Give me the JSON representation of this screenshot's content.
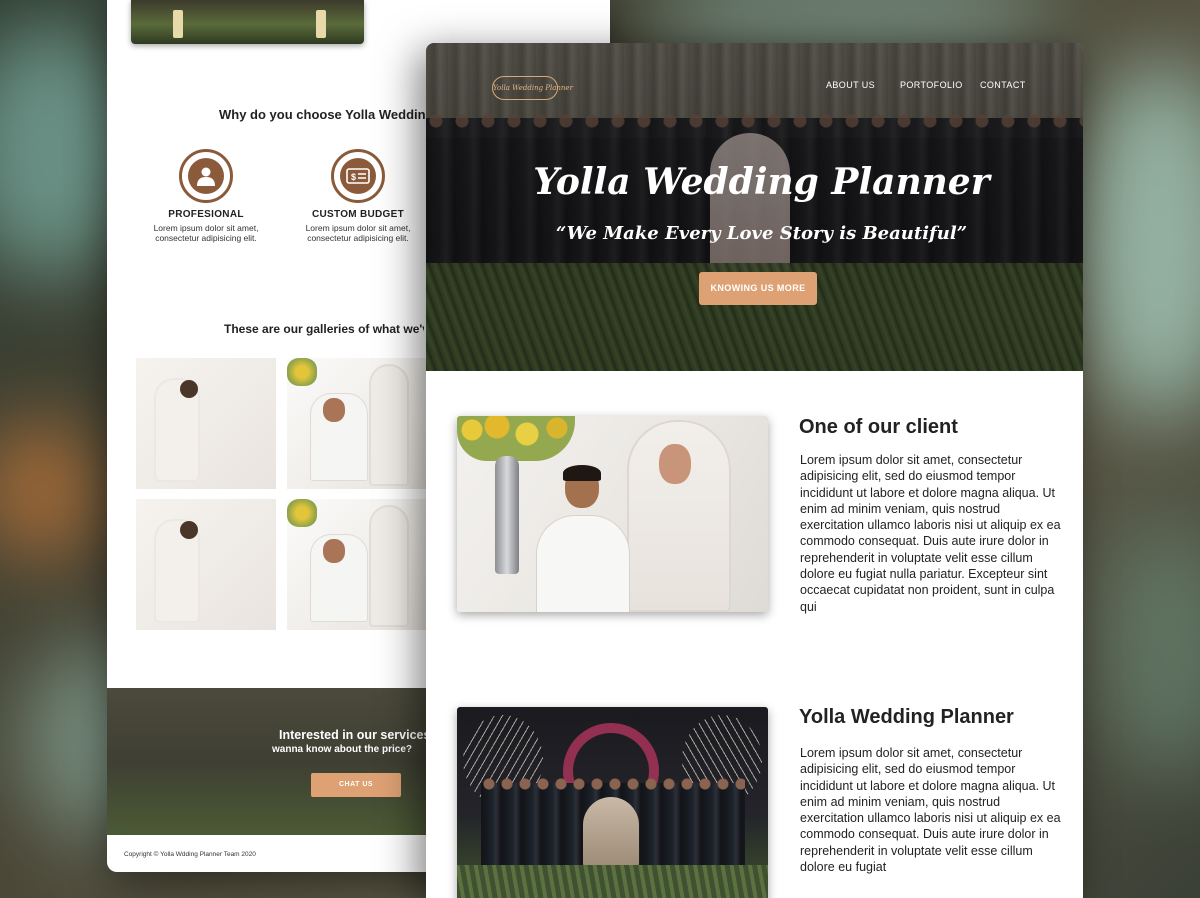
{
  "left_page": {
    "why_title": "Why do you choose Yolla Wedding Planner",
    "features": [
      {
        "icon": "person-icon",
        "title": "PROFESIONAL",
        "desc": "Lorem ipsum dolor sit amet, consectetur adipisicing elit."
      },
      {
        "icon": "budget-icon",
        "title": "CUSTOM BUDGET",
        "desc": "Lorem ipsum dolor sit amet, consectetur adipisicing elit."
      }
    ],
    "gallery_title": "These are our galleries of what we've done",
    "cta": {
      "title": "Interested in our services?",
      "subtitle": "wanna know about the price?",
      "button": "CHAT US"
    },
    "copyright": "Copyright © Yolla Wdding Planner Team 2020"
  },
  "right_page": {
    "logo_text": "Yolla Wedding Planner",
    "nav": [
      "ABOUT US",
      "PORTOFOLIO",
      "CONTACT"
    ],
    "hero_title": "Yolla Wedding Planner",
    "hero_tagline": "“We Make Every Love Story is Beautiful”",
    "hero_button": "KNOWING US MORE",
    "sections": [
      {
        "title": "One of our client",
        "body": "Lorem ipsum dolor sit amet, consectetur adipisicing elit, sed do eiusmod tempor incididunt ut labore et dolore magna aliqua. Ut enim ad minim veniam, quis nostrud exercitation ullamco laboris nisi ut aliquip ex ea commodo consequat. Duis aute irure dolor in reprehenderit in voluptate velit esse cillum dolore eu fugiat nulla pariatur. Excepteur sint occaecat cupidatat non proident, sunt in culpa qui"
      },
      {
        "title": "Yolla Wedding Planner",
        "body": "Lorem ipsum dolor sit amet, consectetur adipisicing elit, sed do eiusmod tempor incididunt ut labore et dolore magna aliqua. Ut enim ad minim veniam, quis nostrud exercitation ullamco laboris nisi ut aliquip ex ea commodo consequat. Duis aute irure dolor in reprehenderit in voluptate velit esse cillum dolore eu fugiat"
      }
    ]
  },
  "colors": {
    "accent": "#dea174",
    "icon_brown": "#8a5a3b",
    "text_dark": "#222222"
  }
}
